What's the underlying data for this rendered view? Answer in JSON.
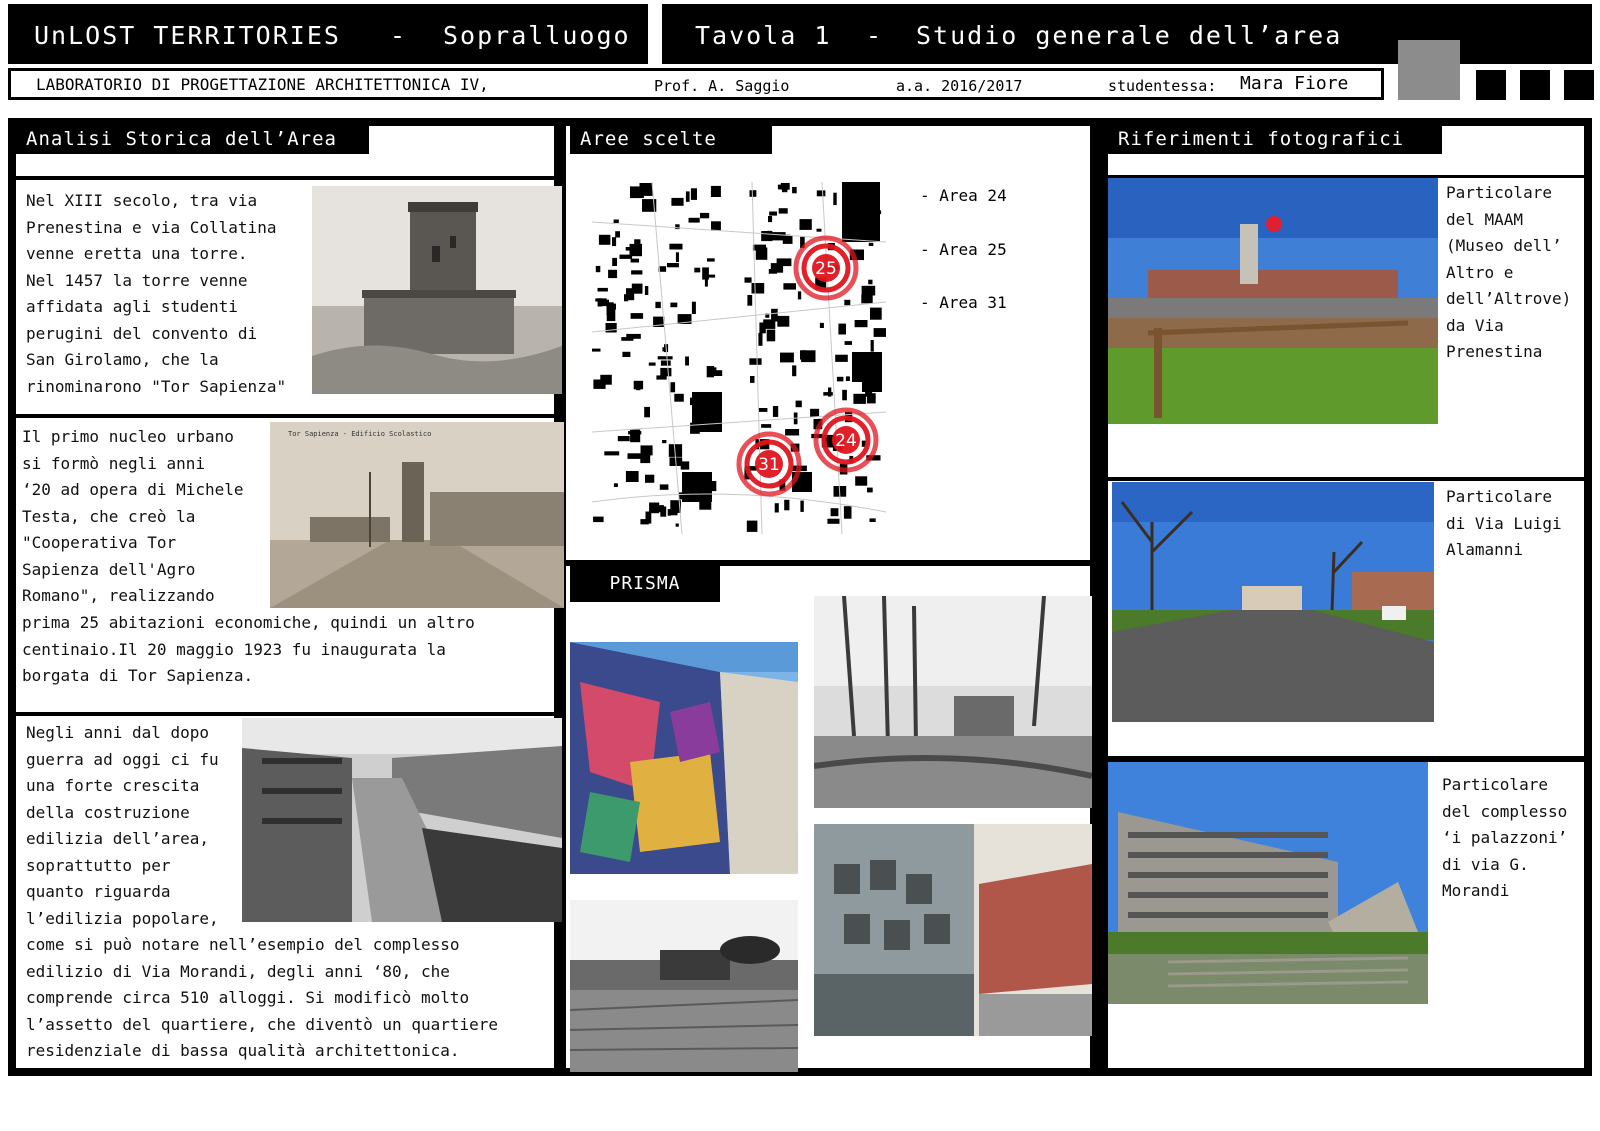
{
  "header": {
    "project": "UnLOST TERRITORIES",
    "separator": "-",
    "phase": "Sopralluogo",
    "board": "Tavola 1",
    "board_title": "Studio generale dell’area",
    "course": "LABORATORIO DI PROGETTAZIONE ARCHITETTONICA IV,",
    "professor": "Prof. A. Saggio",
    "year": "a.a. 2016/2017",
    "student_label": "studentessa:",
    "student_name": "Mara Fiore"
  },
  "sections": {
    "history": "Analisi Storica dell’Area",
    "areas": "Aree scelte",
    "prisma": "PRISMA",
    "photos": "Riferimenti fotografici"
  },
  "history": {
    "p1": "Nel XIII secolo, tra via\nPrenestina e via Collatina\nvenne eretta una torre.\nNel 1457 la torre venne\naffidata agli studenti\nperugini del convento di\nSan Girolamo, che la\nrinominarono \"Tor Sapienza\"",
    "p2_top": "Il primo nucleo urbano\nsi formò negli anni\n‘20 ad opera di Michele\nTesta, che creò la\n\"Cooperativa Tor\nSapienza dell'Agro\nRomano\", realizzando",
    "p2_bottom": "prima 25 abitazioni economiche, quindi un altro\ncentinaio.Il 20 maggio 1923 fu inaugurata la\nborgata di Tor Sapienza.",
    "p3_top": "Negli anni dal dopo\nguerra ad oggi ci fu\nuna forte crescita\ndella costruzione\nedilizia dell’area,\nsoprattutto per\nquanto riguarda\nl’edilizia popolare,",
    "p3_bottom": "come si può notare nell’esempio del complesso\nedilizio di Via Morandi, degli anni ‘80, che\ncomprende circa 510 alloggi. Si modificò molto\nl’assetto del quartiere, che diventò un quartiere\nresidenziale di bassa qualità architettonica.",
    "postcard_caption": "Tor Sapienza - Edificio Scolastico"
  },
  "areas": {
    "legend": [
      "- Area 24",
      "- Area 25",
      "- Area 31"
    ],
    "markers": [
      "25",
      "24",
      "31"
    ]
  },
  "photos": {
    "cap1": "Particolare\ndel MAAM\n(Museo dell’\nAltro e\ndell’Altrove)\nda Via\nPrenestina",
    "cap2": "Particolare\ndi Via Luigi\nAlamanni",
    "cap3": "Particolare\ndel complesso\n‘i palazzoni’\ndi via G.\nMorandi"
  },
  "colors": {
    "frame": "#000000",
    "marker_red": "#e0141e",
    "sky": "#3f7fd6",
    "grass": "#5f9a2c"
  }
}
